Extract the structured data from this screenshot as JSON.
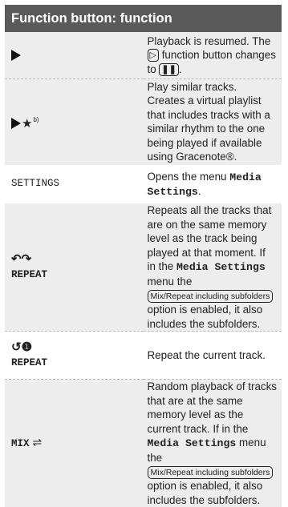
{
  "header": {
    "title": "Function button: function"
  },
  "rows": {
    "play": {
      "desc_pre": "Playback is resumed. The",
      "play_icon": "play-outline-icon",
      "desc_mid": "func­tion button changes to",
      "pause_icon": "pause-icon",
      "desc_post": "."
    },
    "similar": {
      "sup": "b)",
      "line1": "Play similar tracks.",
      "line2": "Creates a virtual playlist that in­cludes tracks with a similar rhythm to the one being played if available using Gracenote®."
    },
    "settings": {
      "label": "SETTINGS",
      "desc_pre": "Opens the menu",
      "desc_key": "Media Set­tings",
      "desc_post": "."
    },
    "repeat_all": {
      "label": "REPEAT",
      "icon": "repeat-icon",
      "desc_pre": "Repeats all the tracks that are on the same memory level as the track being played at that moment. If in the",
      "desc_key": "Media Settings",
      "desc_mid": "menu the",
      "option": "Mix/Repeat including subfolders",
      "desc_post": "option is enabled, it also includes the sub­folders."
    },
    "repeat_one": {
      "label": "REPEAT",
      "icon": "repeat-one-icon",
      "desc": "Repeat the current track."
    },
    "mix": {
      "label": "MIX",
      "icon": "shuffle-icon",
      "desc_pre": "Random playback of tracks that are at the same memory level as the current track. If in the",
      "desc_key": "Media Set­tings",
      "desc_mid": "menu the",
      "option": "Mix/Repeat including subfolders",
      "desc_post": "option is enabled, it also includes the sub­folders."
    }
  }
}
